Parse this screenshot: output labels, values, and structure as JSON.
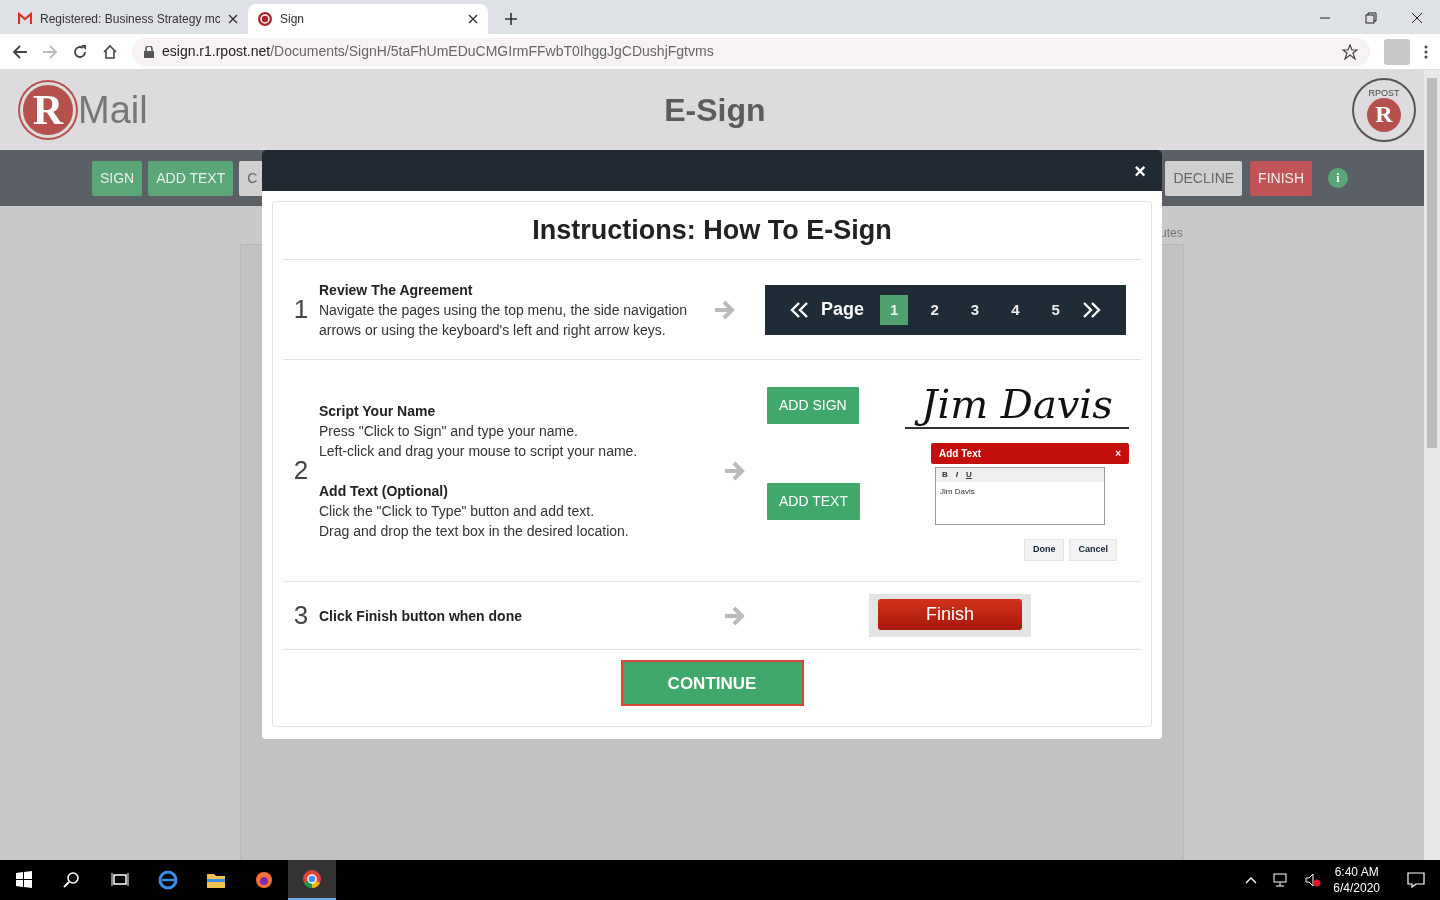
{
  "browser": {
    "tabs": [
      {
        "title": "Registered: Business Strategy mc",
        "kind": "mail",
        "selected": false
      },
      {
        "title": "Sign",
        "kind": "site",
        "selected": true
      }
    ],
    "url": {
      "domain": "esign.r1.rpost.net",
      "path": "/Documents/SignH/5taFhUmEDuCMGIrmFFwbT0IhggJgCDushjFgtvms"
    }
  },
  "header": {
    "logo_letter": "R",
    "logo_text": "Mail",
    "title": "E-Sign",
    "seal_text": "RPOST",
    "seal_letter": "R"
  },
  "toolbar": {
    "left": [
      {
        "label": "SIGN",
        "kind": "green"
      },
      {
        "label": "ADD TEXT",
        "kind": "green"
      },
      {
        "label": "C",
        "kind": "light"
      }
    ],
    "right": [
      {
        "label": "DECLINE",
        "kind": "light"
      },
      {
        "label": "FINISH",
        "kind": "red"
      }
    ],
    "info": "i"
  },
  "side_note": "utes",
  "modal": {
    "close": "×",
    "title": "Instructions: How To E-Sign",
    "step1": {
      "number": "1",
      "heading": "Review The Agreement",
      "text": "Navigate the pages using the top menu, the side navigation arrows or using the keyboard's left and right arrow keys.",
      "pager_label": "Page",
      "pages": [
        {
          "label": "1",
          "selected": true
        },
        {
          "label": "2",
          "selected": false
        },
        {
          "label": "3",
          "selected": false
        },
        {
          "label": "4",
          "selected": false
        },
        {
          "label": "5",
          "selected": false
        }
      ]
    },
    "step2": {
      "number": "2",
      "sections": [
        {
          "heading": "Script Your Name",
          "lines": [
            "Press \"Click to Sign\" and type your name.",
            "Left-click and drag your mouse to script your name."
          ]
        },
        {
          "heading": "Add Text (Optional)",
          "lines": [
            "Click the \"Click to Type\" button and add text.",
            "Drag and drop the text box in the desired location."
          ]
        }
      ],
      "add_sign": "ADD SIGN",
      "signature": "Jim Davis",
      "add_text": "ADD TEXT",
      "dialog": {
        "title": "Add Text",
        "close": "×",
        "format": [
          "B",
          "I",
          "U"
        ],
        "text": "Jim Davis",
        "buttons": [
          "Done",
          "Cancel"
        ]
      }
    },
    "step3": {
      "number": "3",
      "heading": "Click Finish button when done",
      "finish": "Finish"
    },
    "continue": "CONTINUE"
  },
  "taskbar": {
    "time": "6:40 AM",
    "date": "6/4/2020"
  }
}
